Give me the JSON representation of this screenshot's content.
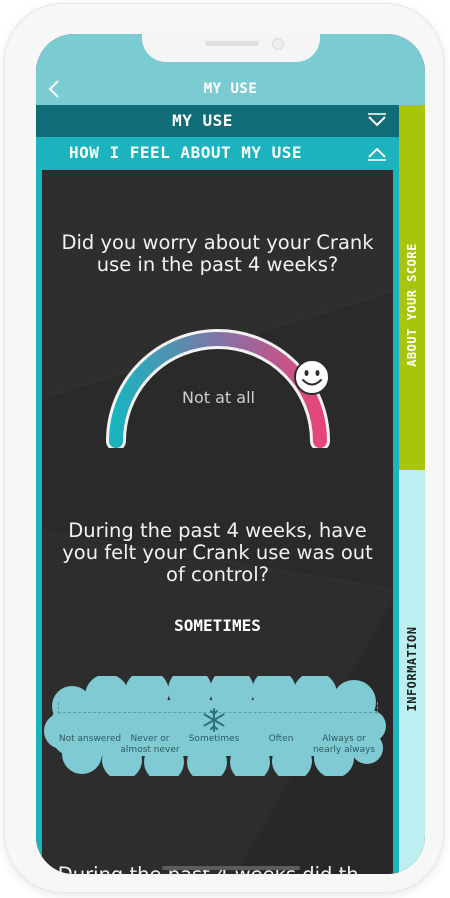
{
  "header": {
    "title": "MY USE",
    "back_icon": "chevron-left-icon"
  },
  "accordion": {
    "section1": {
      "title": "MY USE",
      "state_icon": "chevron-down-icon"
    },
    "section2": {
      "title": "HOW I FEEL ABOUT MY USE",
      "state_icon": "chevron-up-icon"
    }
  },
  "question1": {
    "text": "Did you worry about your Crank use in the past 4 weeks?",
    "gauge_value_label": "Not at all",
    "handle_icon": "smiley-icon"
  },
  "question2": {
    "text": "During the past 4 weeks, have you felt your Crank use was out of control?",
    "selected_answer": "SOMETIMES",
    "marker_icon": "snowflake-icon",
    "options": [
      "Not answered",
      "Never or almost never",
      "Sometimes",
      "Often",
      "Always or nearly always"
    ]
  },
  "question3": {
    "text_partial": "During the past 4 weeks did th..."
  },
  "side_tabs": {
    "score": "ABOUT YOUR SCORE",
    "info": "INFORMATION"
  },
  "colors": {
    "header_bg": "#7acbd2",
    "section1_bg": "#106c76",
    "section2_bg": "#1ab3be",
    "content_bg": "#2c2c2c",
    "score_tab": "#a8c40c",
    "info_tab": "#bdeef0",
    "cloud": "#7fcad3",
    "gauge_start": "#1ab3be",
    "gauge_end": "#e6457a"
  }
}
